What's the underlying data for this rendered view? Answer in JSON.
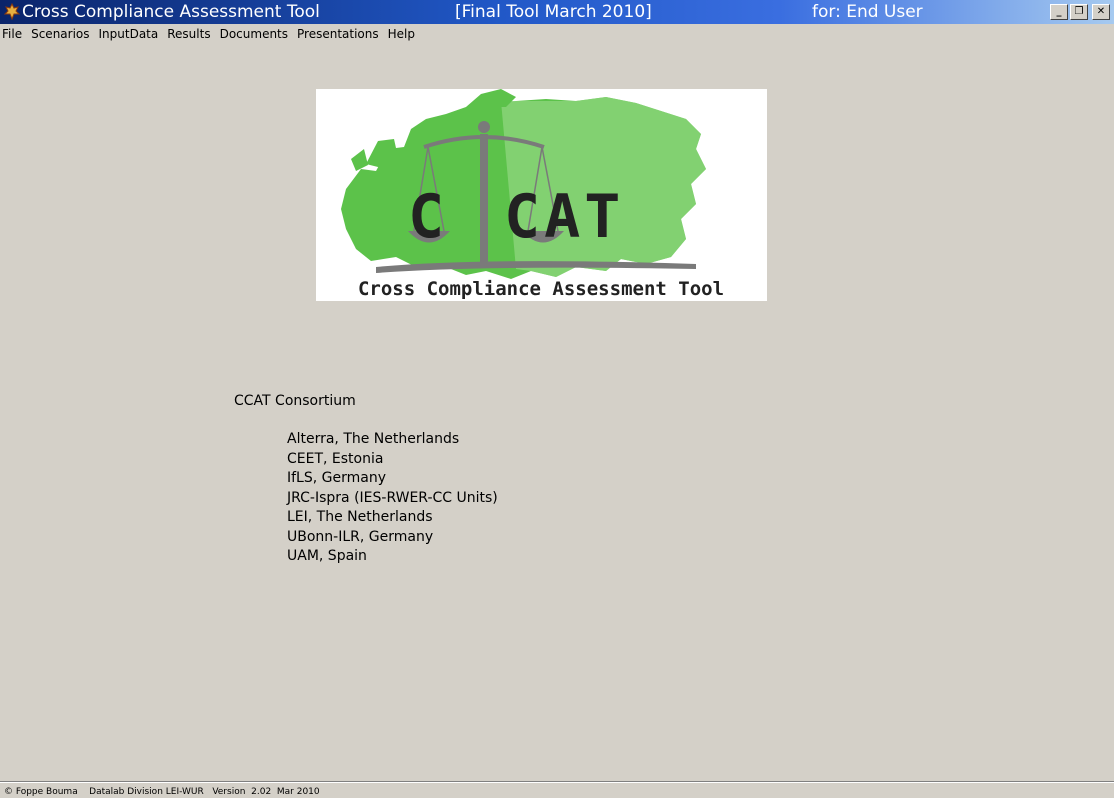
{
  "window": {
    "title": "Cross Compliance Assessment Tool",
    "edition": "[Final Tool   March 2010]",
    "user_label": "for:  End User",
    "minimize_symbol": "_",
    "maximize_symbol": "❐",
    "close_symbol": "✕"
  },
  "menu": {
    "items": [
      "File",
      "Scenarios",
      "InputData",
      "Results",
      "Documents",
      "Presentations",
      "Help"
    ]
  },
  "logo": {
    "acronym": "CCAT",
    "caption": "Cross Compliance Assessment Tool",
    "colors": {
      "map": "#5cc24a",
      "map_light": "#8fd67f",
      "scale": "#7a7a7a",
      "text": "#222222"
    }
  },
  "consortium": {
    "heading": "CCAT Consortium",
    "partners": [
      "Alterra, The Netherlands",
      "CEET, Estonia",
      "IfLS, Germany",
      "JRC-Ispra (IES-RWER-CC Units)",
      "LEI, The Netherlands",
      "UBonn-ILR, Germany",
      "UAM, Spain"
    ]
  },
  "status": {
    "text": "© Foppe Bouma    Datalab Division LEI-WUR   Version  2.02  Mar 2010"
  }
}
